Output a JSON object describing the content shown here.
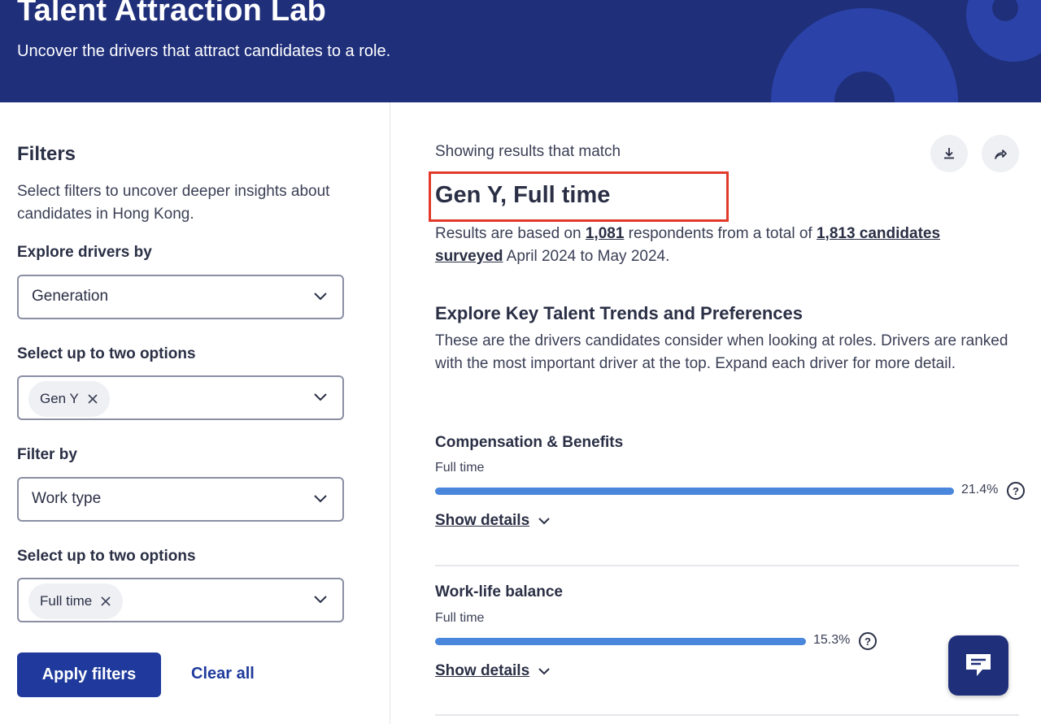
{
  "hero": {
    "title": "Talent Attraction Lab",
    "subtitle": "Uncover the drivers that attract candidates to a role."
  },
  "sidebar": {
    "title": "Filters",
    "description": "Select filters to uncover deeper insights about candidates in Hong Kong.",
    "explore_label": "Explore drivers by",
    "explore_value": "Generation",
    "options1_label": "Select up to two options",
    "options1_chips": [
      "Gen Y"
    ],
    "filter_label": "Filter by",
    "filter_value": "Work type",
    "options2_label": "Select up to two options",
    "options2_chips": [
      "Full time"
    ],
    "apply_label": "Apply filters",
    "clear_label": "Clear all"
  },
  "main": {
    "showing_label": "Showing results that match",
    "result_title": "Gen Y, Full time",
    "summary": {
      "pre": "Results are based on ",
      "respondents": "1,081",
      "mid": " respondents from a total of ",
      "candidates": "1,813 candidates surveyed",
      "post": " April 2024 to May 2024."
    },
    "section_title": "Explore Key Talent Trends and Preferences",
    "section_desc": "These are the drivers candidates consider when looking at roles. Drivers are ranked with the most important driver at the top. Expand each driver for more detail.",
    "drivers": [
      {
        "title": "Compensation & Benefits",
        "sub": "Full time",
        "pct_label": "21.4%",
        "value": 21.4,
        "details_label": "Show details"
      },
      {
        "title": "Work-life balance",
        "sub": "Full time",
        "pct_label": "15.3%",
        "value": 15.3,
        "details_label": "Show details"
      }
    ]
  },
  "icons": {
    "download": "download-icon",
    "share": "share-icon",
    "chat": "chat-icon",
    "help": "help-icon"
  },
  "colors": {
    "hero_bg": "#1f2f7a",
    "accent": "#1f3a9c",
    "bar": "#4a86dc",
    "highlight": "#e23a2a"
  }
}
